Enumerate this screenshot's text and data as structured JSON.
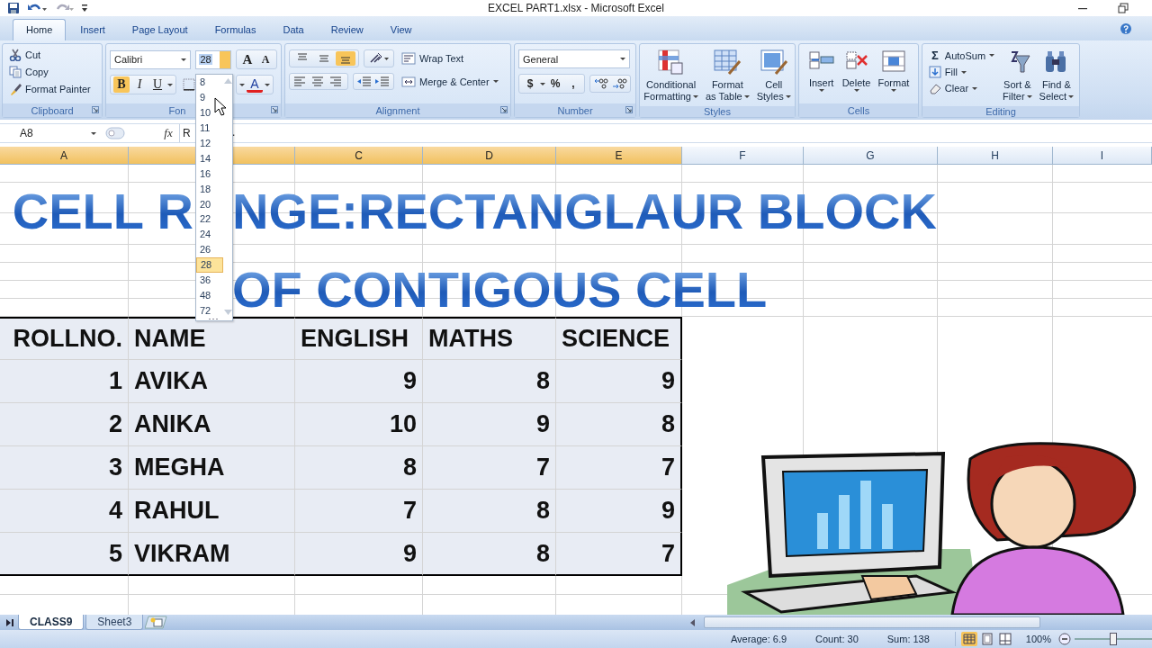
{
  "window": {
    "title": "EXCEL PART1.xlsx - Microsoft Excel"
  },
  "ribbon_tabs": [
    {
      "label": "Home",
      "selected": true
    },
    {
      "label": "Insert",
      "selected": false
    },
    {
      "label": "Page Layout",
      "selected": false
    },
    {
      "label": "Formulas",
      "selected": false
    },
    {
      "label": "Data",
      "selected": false
    },
    {
      "label": "Review",
      "selected": false
    },
    {
      "label": "View",
      "selected": false
    }
  ],
  "clipboard": {
    "label": "Clipboard",
    "items": [
      "Cut",
      "Copy",
      "Format Painter"
    ]
  },
  "font": {
    "label": "Fon",
    "name": "Calibri",
    "size": "28",
    "grow": "A",
    "shrink": "A",
    "color_label": "A",
    "style_buttons": [
      {
        "label": "B",
        "selected": true,
        "kind": "bold"
      },
      {
        "label": "I",
        "selected": false,
        "kind": "italic"
      },
      {
        "label": "U",
        "selected": false,
        "kind": "underline"
      }
    ]
  },
  "font_size_list": [
    {
      "label": "8",
      "selected": false
    },
    {
      "label": "9",
      "selected": false
    },
    {
      "label": "10",
      "selected": false
    },
    {
      "label": "11",
      "selected": false
    },
    {
      "label": "12",
      "selected": false
    },
    {
      "label": "14",
      "selected": false
    },
    {
      "label": "16",
      "selected": false
    },
    {
      "label": "18",
      "selected": false
    },
    {
      "label": "20",
      "selected": false
    },
    {
      "label": "22",
      "selected": false
    },
    {
      "label": "24",
      "selected": false
    },
    {
      "label": "26",
      "selected": false
    },
    {
      "label": "28",
      "selected": true
    },
    {
      "label": "36",
      "selected": false
    },
    {
      "label": "48",
      "selected": false
    },
    {
      "label": "72",
      "selected": false
    }
  ],
  "alignment": {
    "label": "Alignment",
    "wrap_text": "Wrap Text",
    "merge": "Merge & Center",
    "vertical": [
      {
        "selected": false
      },
      {
        "selected": false
      },
      {
        "selected": true
      }
    ]
  },
  "number": {
    "label": "Number",
    "format": "General",
    "buttons": [
      "$",
      "%",
      ","
    ]
  },
  "styles": {
    "label": "Styles",
    "buttons": [
      [
        "Conditional",
        "Formatting"
      ],
      [
        "Format",
        "as Table"
      ],
      [
        "Cell",
        "Styles"
      ]
    ]
  },
  "cells": {
    "label": "Cells",
    "buttons": [
      "Insert",
      "Delete",
      "Format"
    ]
  },
  "editing": {
    "label": "Editing",
    "sum_symbol": "Σ",
    "small": [
      "AutoSum",
      "Fill",
      "Clear"
    ],
    "buttons": [
      [
        "Sort &",
        "Filter"
      ],
      [
        "Find &",
        "Select"
      ]
    ]
  },
  "formula_bar": {
    "name_box": "A8",
    "fx": "fx",
    "value_parts": [
      "R",
      "."
    ]
  },
  "columns": [
    {
      "label": "A",
      "selected": true
    },
    {
      "selected": true
    },
    {
      "label": "C",
      "selected": true
    },
    {
      "label": "D",
      "selected": true
    },
    {
      "label": "E",
      "selected": true
    },
    {
      "label": "F",
      "selected": false
    },
    {
      "label": "G",
      "selected": false
    },
    {
      "label": "H",
      "selected": false
    },
    {
      "label": "I",
      "selected": false
    }
  ],
  "wordart": {
    "line_1_parts": [
      "CELL R",
      "NGE:RECTANGLAUR BLOCK"
    ],
    "line_2": "OF CONTIGOUS CELL"
  },
  "table": {
    "columns": [
      "ROLLNO.",
      "NAME",
      "ENGLISH",
      "MATHS",
      "SCIENCE"
    ],
    "rows": [
      [
        "1",
        "AVIKA",
        "9",
        "8",
        "9"
      ],
      [
        "2",
        "ANIKA",
        "10",
        "9",
        "8"
      ],
      [
        "3",
        "MEGHA",
        "8",
        "7",
        "7"
      ],
      [
        "4",
        "RAHUL",
        "7",
        "8",
        "9"
      ],
      [
        "5",
        "VIKRAM",
        "9",
        "8",
        "7"
      ]
    ]
  },
  "sheet_tabs": [
    {
      "label": "CLASS9",
      "selected": true
    },
    {
      "label": "Sheet3",
      "selected": false
    }
  ],
  "status_bar": {
    "average": "Average: 6.9",
    "count": "Count: 30",
    "sum": "Sum: 138",
    "zoom": "100%",
    "views": [
      {
        "selected": true
      },
      {
        "selected": false
      },
      {
        "selected": false
      }
    ],
    "zoom_slider": {
      "level": 0.5
    }
  }
}
